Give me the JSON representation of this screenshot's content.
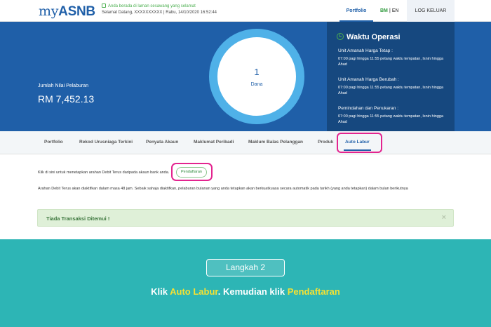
{
  "header": {
    "logo_prefix": "my",
    "logo_main": "ASNB",
    "secure_notice": "Anda berada di laman sesawang yang selamat",
    "welcome": "Selamat Datang, XXXXXXXXXX | Rabu, 14/10/2020 16:52:44",
    "nav_portfolio": "Portfolio",
    "lang_bm": "BM",
    "lang_sep": "|",
    "lang_en": "EN",
    "logout": "LOG KELUAR"
  },
  "banner": {
    "nilai_label": "Jumlah Nilai Pelaburan",
    "nilai_value": "RM 7,452.13",
    "dana_count": "1",
    "dana_label": "Dana"
  },
  "ops": {
    "title": "Waktu Operasi",
    "sections": [
      {
        "heading": "Unit Amanah Harga Tetap :",
        "detail": "07:00 pagi hingga 11:55 petang waktu tempatan, Isnin hingga Ahad"
      },
      {
        "heading": "Unit Amanah Harga Berubah :",
        "detail": "07:00 pagi hingga 11:55 petang waktu tempatan, Isnin hingga Ahad"
      },
      {
        "heading": "Pemindahan dan Penukaran :",
        "detail": "07:00 pagi hingga 11:55 petang waktu tempatan, Isnin hingga Ahad"
      }
    ]
  },
  "tabs": [
    {
      "label": "Portfolio"
    },
    {
      "label": "Rekod Urusniaga Terkini"
    },
    {
      "label": "Penyata Akaun"
    },
    {
      "label": "Maklumat Peribadi"
    },
    {
      "label": "Maklum Balas Pelanggan"
    },
    {
      "label": "Produk"
    },
    {
      "label": "Auto Labur"
    }
  ],
  "content": {
    "text1": "Klik di sini untuk menetapkan arahan Debit Terus daripada akaun bank anda.",
    "pendaftaran": "Pendaftaran",
    "text2": "Arahan Debit Terus akan diaktifkan dalam masa 48 jam. Sebaik sahaja diaktifkan, pelaburan bulanan yang anda tetapkan akan berkuatkuasa secara automatik pada tarikh (yang anda tetapkan) dalam bulan berikutnya",
    "alert": "Tiada Transaksi Ditemui !",
    "alert_close": "×"
  },
  "instruction": {
    "step": "Langkah 2",
    "part1": "Klik ",
    "part2": "Auto Labur",
    "part3": ". Kemudian klik ",
    "part4": "Pendaftaran"
  },
  "colors": {
    "brand_blue": "#1f5fa8",
    "highlight": "#e3248f",
    "teal": "#2db5b5",
    "yellow": "#f5e133"
  }
}
